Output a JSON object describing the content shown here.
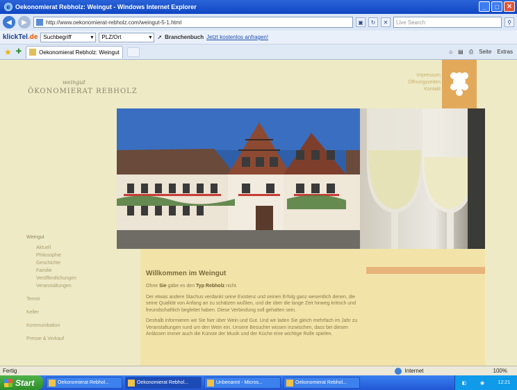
{
  "window": {
    "title": "Oekonomierat Rebholz: Weingut - Windows Internet Explorer"
  },
  "addressbar": {
    "url": "http://www.oekonomierat-rebholz.com/weingut-5-1.html",
    "search_placeholder": "Live Search"
  },
  "toolbar": {
    "brand_a": "klickTel",
    "brand_b": ".de",
    "select1": "Suchbegriff",
    "select2": "PLZ/Ort",
    "branchenbuch": "Branchenbuch",
    "link": "Jetzt kostenlos anfragen!"
  },
  "tab": {
    "label": "Oekonomierat Rebholz: Weingut",
    "tools": [
      "Seite",
      "Extras"
    ]
  },
  "site": {
    "brand_small": "weingut",
    "brand": "ÖKONOMIERAT REBHOLZ",
    "toplinks": [
      "Impressum",
      "Öffnungszeiten",
      "Kontakt"
    ],
    "nav": {
      "head": "Weingut",
      "sub": [
        "Aktuell",
        "Philosophie",
        "Geschichte",
        "Familie",
        "Veröffentlichungen",
        "Veranstaltungen"
      ],
      "top": [
        "Terroir",
        "Keller",
        "Kommunikation",
        "Presse & Verkauf"
      ]
    },
    "content": {
      "heading": "Willkommen im Weingut",
      "p1_pre": "Ohne",
      "p1_b1": "Sie",
      "p1_mid": "gäbe es den",
      "p1_b2": "Typ Rebholz",
      "p1_post": "nicht.",
      "p2": "Der etwas andere Stachus verdankt seine Existenz und seinen Erfolg ganz wesentlich denen, die seine Qualität von Anfang an zu schätzen wußten, und die über die lange Zeit hinweg kritisch und freundschaftlich begleitet haben. Diese Verbindung soll gehalten sein.",
      "p3": "Deshalb informieren wir Sie hier über Wein und Gut. Und wir laden Sie gleich mehrfach im Jahr zu Veranstaltungen rund um den Wein ein. Unsere Besucher wissen inzwischen, dass bei diesen Anlässen immer auch die Künste der Musik und der Küche eine wichtige Rolle spielen."
    }
  },
  "statusbar": {
    "left": "Fertig",
    "zone": "Internet",
    "zoom": "100%"
  },
  "taskbar": {
    "start": "Start",
    "tasks": [
      "Oekonomierat Rebhol...",
      "Oekonomierat Rebhol...",
      "Unbenannt - Micros...",
      "Oekonomierat Rebhol..."
    ],
    "clock": "12:21"
  }
}
